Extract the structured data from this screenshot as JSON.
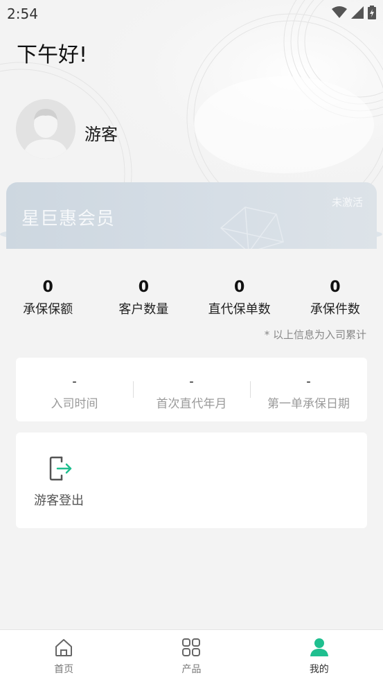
{
  "status_bar": {
    "time": "2:54"
  },
  "greeting": "下午好!",
  "user": {
    "name": "游客"
  },
  "member_card": {
    "title": "星巨惠会员",
    "status": "未激活"
  },
  "stats": [
    {
      "value": "0",
      "label": "承保保额"
    },
    {
      "value": "0",
      "label": "客户数量"
    },
    {
      "value": "0",
      "label": "直代保单数"
    },
    {
      "value": "0",
      "label": "承保件数"
    }
  ],
  "stats_note": "* 以上信息为入司累计",
  "info": [
    {
      "value": "-",
      "label": "入司时间"
    },
    {
      "value": "-",
      "label": "首次直代年月"
    },
    {
      "value": "-",
      "label": "第一单承保日期"
    }
  ],
  "actions": {
    "logout_label": "游客登出"
  },
  "tabs": [
    {
      "label": "首页",
      "icon": "home-icon"
    },
    {
      "label": "产品",
      "icon": "grid-icon"
    },
    {
      "label": "我的",
      "icon": "person-icon",
      "active": true
    }
  ],
  "colors": {
    "accent": "#1fbf8f",
    "background": "#f3f3f3",
    "card": "#ffffff"
  }
}
